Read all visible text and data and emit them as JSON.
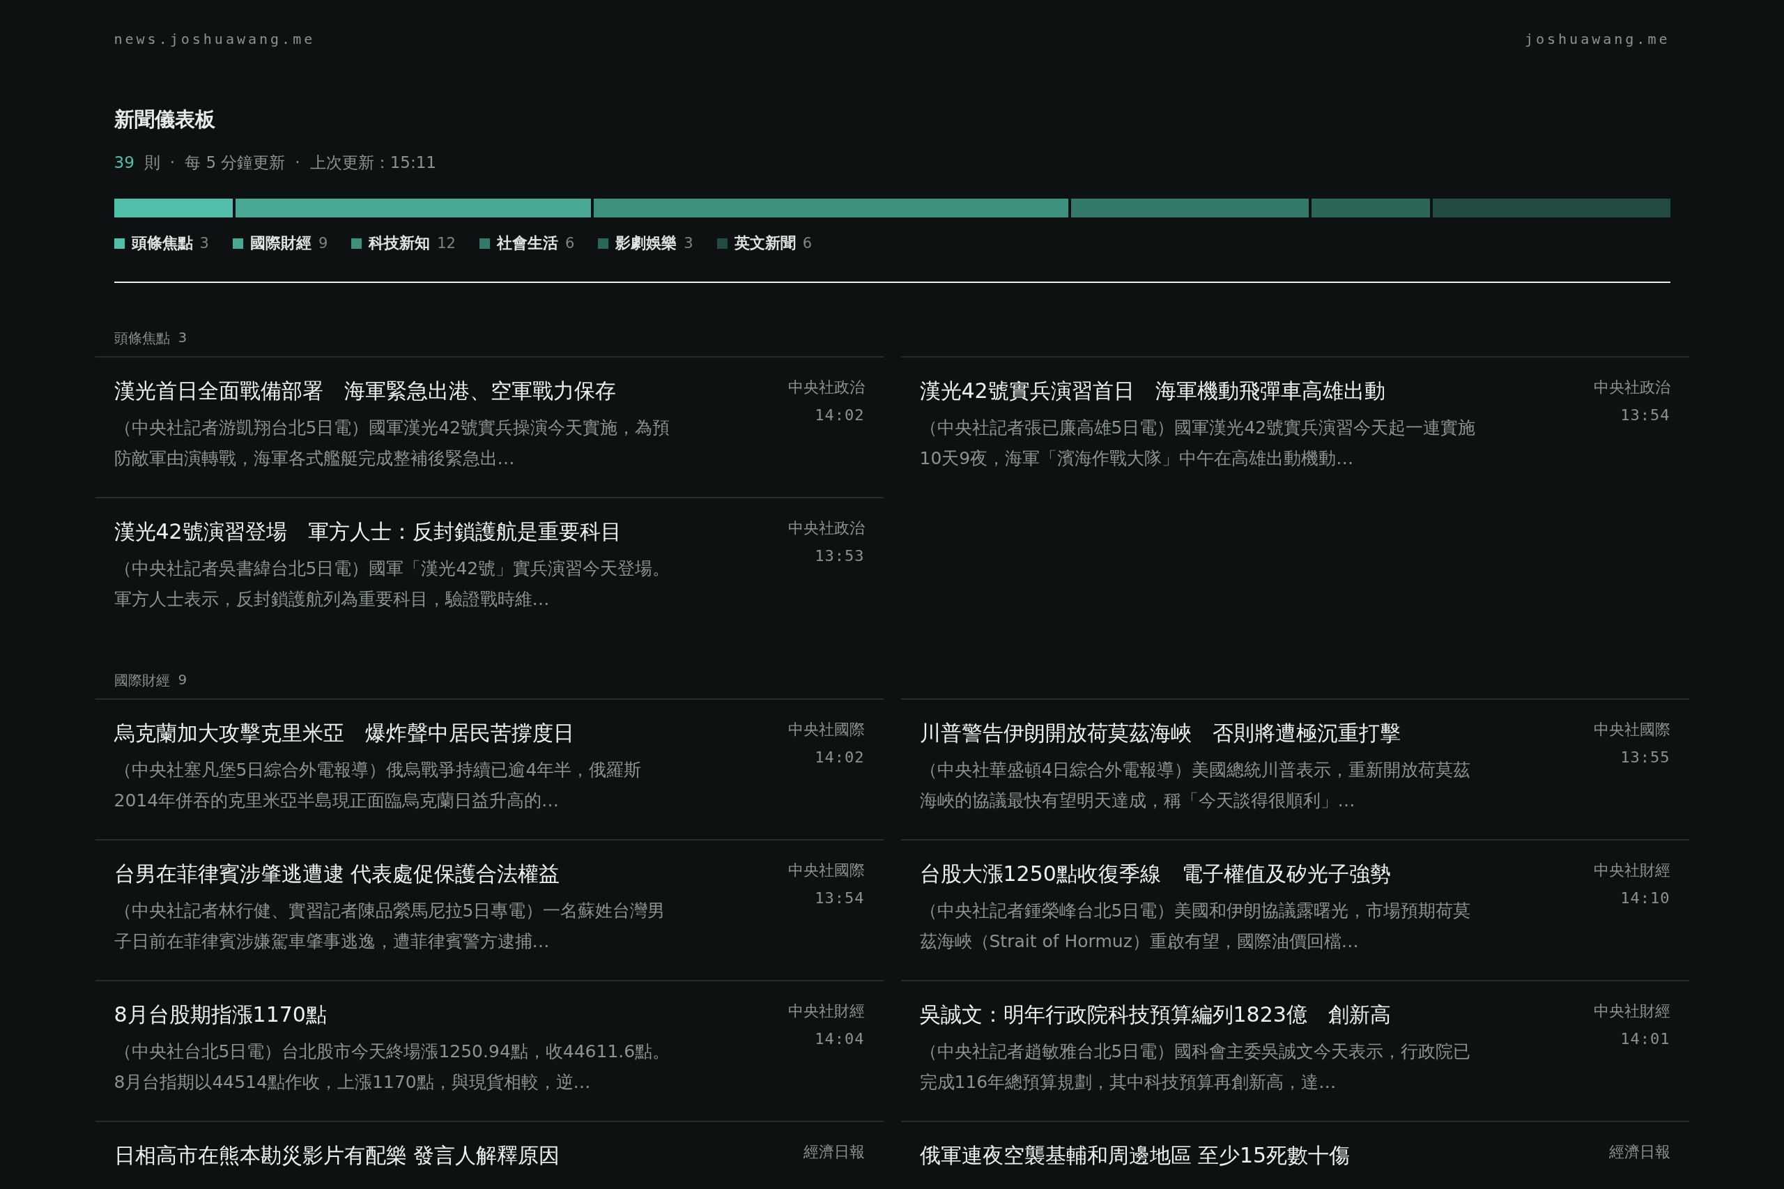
{
  "header": {
    "site": "news.joshuawang.me",
    "link": "joshuawang.me"
  },
  "dashboard": {
    "title": "新聞儀表板",
    "total": "39",
    "total_unit": "則",
    "separator": "·",
    "refresh": "每 5 分鐘更新",
    "updated": "上次更新：15:11"
  },
  "categories": [
    {
      "name": "頭條焦點",
      "count": "3",
      "color": "#52bfab"
    },
    {
      "name": "國際財經",
      "count": "9",
      "color": "#48a894"
    },
    {
      "name": "科技新知",
      "count": "12",
      "color": "#3e917f"
    },
    {
      "name": "社會生活",
      "count": "6",
      "color": "#337a6a"
    },
    {
      "name": "影劇娛樂",
      "count": "3",
      "color": "#2b6657"
    },
    {
      "name": "英文新聞",
      "count": "6",
      "color": "#224c43"
    }
  ],
  "sections": [
    {
      "label": "頭條焦點",
      "count": "3",
      "items": [
        {
          "title": "漢光首日全面戰備部署　海軍緊急出港、空軍戰力保存",
          "summary": "（中央社記者游凱翔台北5日電）國軍漢光42號實兵操演今天實施，為預防敵軍由演轉戰，海軍各式艦艇完成整補後緊急出…",
          "source": "中央社政治",
          "time": "14:02"
        },
        {
          "title": "漢光42號實兵演習首日　海軍機動飛彈車高雄出動",
          "summary": "（中央社記者張已廉高雄5日電）國軍漢光42號實兵演習今天起一連實施10天9夜，海軍「濱海作戰大隊」中午在高雄出動機動…",
          "source": "中央社政治",
          "time": "13:54"
        },
        {
          "title": "漢光42號演習登場　軍方人士：反封鎖護航是重要科目",
          "summary": "（中央社記者吳書緯台北5日電）國軍「漢光42號」實兵演習今天登場。軍方人士表示，反封鎖護航列為重要科目，驗證戰時維…",
          "source": "中央社政治",
          "time": "13:53"
        }
      ]
    },
    {
      "label": "國際財經",
      "count": "9",
      "items": [
        {
          "title": "烏克蘭加大攻擊克里米亞　爆炸聲中居民苦撐度日",
          "summary": "（中央社塞凡堡5日綜合外電報導）俄烏戰爭持續已逾4年半，俄羅斯2014年併吞的克里米亞半島現正面臨烏克蘭日益升高的…",
          "source": "中央社國際",
          "time": "14:02"
        },
        {
          "title": "川普警告伊朗開放荷莫茲海峽　否則將遭極沉重打擊",
          "summary": "（中央社華盛頓4日綜合外電報導）美國總統川普表示，重新開放荷莫茲海峽的協議最快有望明天達成，稱「今天談得很順利」…",
          "source": "中央社國際",
          "time": "13:55"
        },
        {
          "title": "台男在菲律賓涉肇逃遭逮 代表處促保護合法權益",
          "summary": "（中央社記者林行健、實習記者陳品縈馬尼拉5日專電）一名蘇姓台灣男子日前在菲律賓涉嫌駕車肇事逃逸，遭菲律賓警方逮捕…",
          "source": "中央社國際",
          "time": "13:54"
        },
        {
          "title": "台股大漲1250點收復季線　電子權值及矽光子強勢",
          "summary": "（中央社記者鍾榮峰台北5日電）美國和伊朗協議露曙光，市場預期荷莫茲海峽（Strait of Hormuz）重啟有望，國際油價回檔…",
          "source": "中央社財經",
          "time": "14:10"
        },
        {
          "title": "8月台股期指漲1170點",
          "summary": "（中央社台北5日電）台北股市今天終場漲1250.94點，收44611.6點。8月台指期以44514點作收，上漲1170點，與現貨相較，逆…",
          "source": "中央社財經",
          "time": "14:04"
        },
        {
          "title": "吳誠文：明年行政院科技預算編列1823億　創新高",
          "summary": "（中央社記者趙敏雅台北5日電）國科會主委吳誠文今天表示，行政院已完成116年總預算規劃，其中科技預算再創新高，達…",
          "source": "中央社財經",
          "time": "14:01"
        },
        {
          "title": "日相高市在熊本勘災影片有配樂 發言人解釋原因",
          "source": "經濟日報"
        },
        {
          "title": "俄軍連夜空襲基輔和周邊地區 至少15死數十傷",
          "source": "經濟日報"
        }
      ]
    }
  ]
}
